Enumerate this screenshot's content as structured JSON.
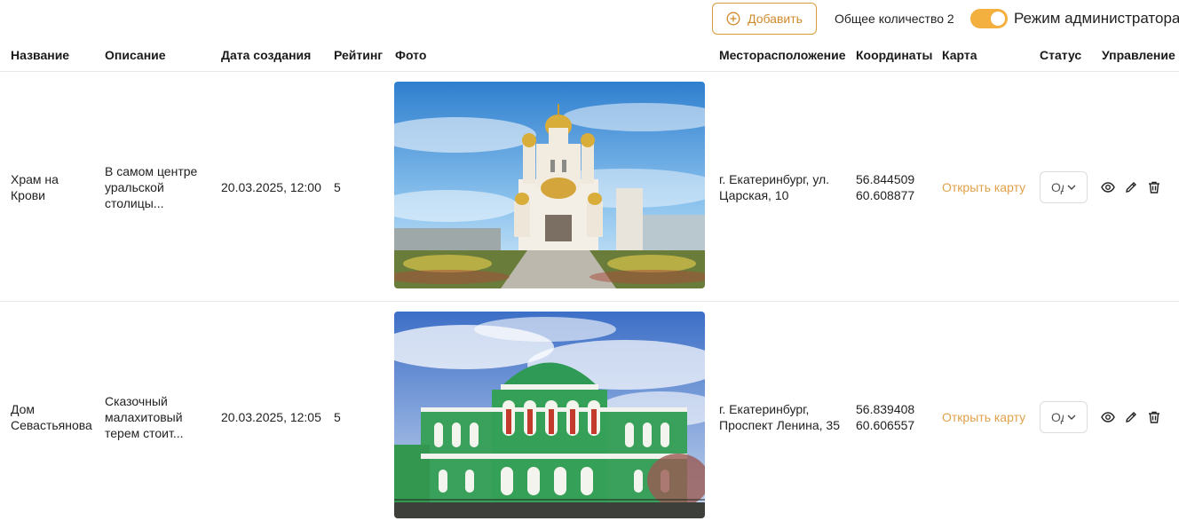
{
  "toolbar": {
    "add_label": "Добавить",
    "add_icon": "plus-circle-icon",
    "total_text": "Общее количество 2",
    "admin_mode_label": "Режим администратора",
    "admin_mode_on": true,
    "accent_color": "#f4b03f"
  },
  "table": {
    "columns": [
      "Название",
      "Описание",
      "Дата создания",
      "Рейтинг",
      "Фото",
      "Месторасположение",
      "Координаты",
      "Карта",
      "Статус",
      "Управление"
    ],
    "rows": [
      {
        "name_line1": "Храм на",
        "name_line2": "Крови",
        "desc_line1": "В самом центре",
        "desc_line2": "уральской",
        "desc_line3": "столицы...",
        "date": "20.03.2025, 12:00",
        "rating": "5",
        "photo": "Church on the Blood with golden domes under blue sky",
        "location_line1": "г. Екатеринбург, ул.",
        "location_line2": "Царская, 10",
        "lat": "56.844509",
        "lon": "60.608877",
        "map_link": "Открыть карту",
        "status": "Од"
      },
      {
        "name_line1": "Дом",
        "name_line2": "Севастьянова",
        "desc_line1": "Сказочный",
        "desc_line2": "малахитовый",
        "desc_line3": "терем стоит...",
        "date": "20.03.2025, 12:05",
        "rating": "5",
        "photo": "Sevastyanov House, green and white facade",
        "location_line1": "г. Екатеринбург,",
        "location_line2": "Проспект Ленина, 35",
        "lat": "56.839408",
        "lon": "60.606557",
        "map_link": "Открыть карту",
        "status": "Од"
      }
    ],
    "action_icons": [
      "eye-icon",
      "pencil-icon",
      "trash-icon"
    ]
  }
}
